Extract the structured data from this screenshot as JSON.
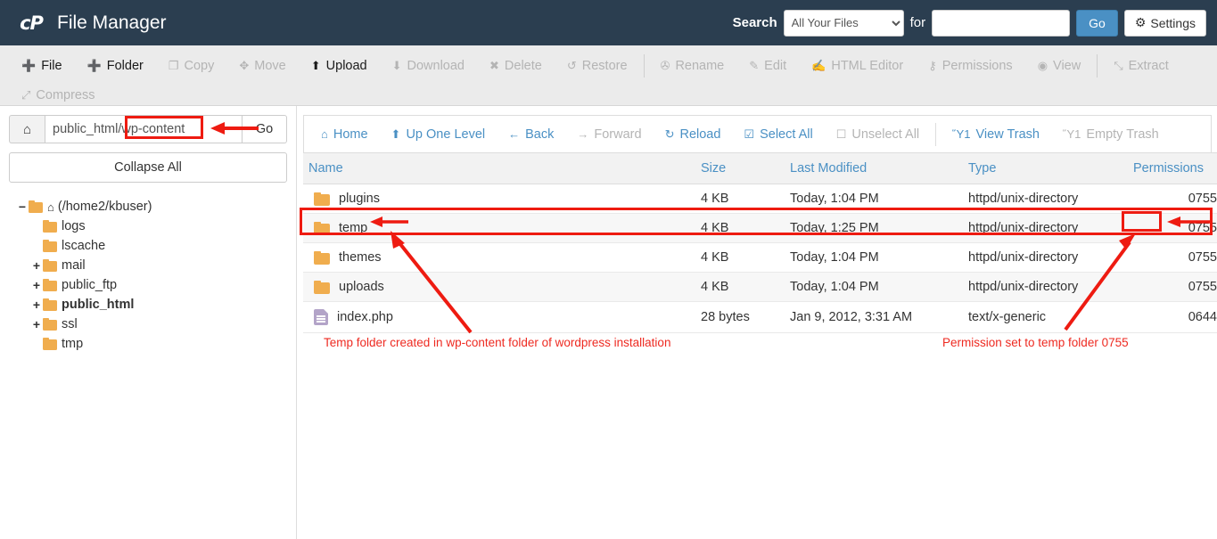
{
  "header": {
    "logo_text": "cP",
    "title": "File Manager",
    "search_label": "Search",
    "search_scope": "All Your Files",
    "search_scope_options": [
      "All Your Files"
    ],
    "for_label": "for",
    "search_value": "",
    "search_placeholder": "",
    "go_label": "Go",
    "settings_label": "Settings"
  },
  "toolbar": {
    "row1": [
      {
        "label": "File",
        "icon": "plus-icon",
        "glyph": "➕",
        "enabled": true
      },
      {
        "label": "Folder",
        "icon": "plus-icon",
        "glyph": "➕",
        "enabled": true
      },
      {
        "label": "Copy",
        "icon": "copy-icon",
        "glyph": "❐",
        "enabled": false
      },
      {
        "label": "Move",
        "icon": "move-icon",
        "glyph": "✥",
        "enabled": false
      },
      {
        "label": "Upload",
        "icon": "upload-icon",
        "glyph": "⬆",
        "enabled": true
      },
      {
        "label": "Download",
        "icon": "download-icon",
        "glyph": "⬇",
        "enabled": false
      },
      {
        "label": "Delete",
        "icon": "x-icon",
        "glyph": "✖",
        "enabled": false
      },
      {
        "label": "Restore",
        "icon": "undo-icon",
        "glyph": "↺",
        "enabled": false
      },
      {
        "label": "Rename",
        "icon": "file-icon",
        "glyph": "✇",
        "enabled": false
      },
      {
        "label": "Edit",
        "icon": "pencil-icon",
        "glyph": "✎",
        "enabled": false
      },
      {
        "label": "HTML Editor",
        "icon": "html-editor-icon",
        "glyph": "✍",
        "enabled": false
      },
      {
        "label": "Permissions",
        "icon": "key-icon",
        "glyph": "⚷",
        "enabled": false
      },
      {
        "label": "View",
        "icon": "eye-icon",
        "glyph": "◉",
        "enabled": false
      },
      {
        "label": "Extract",
        "icon": "extract-icon",
        "glyph": "⤡",
        "enabled": false
      }
    ],
    "row2": [
      {
        "label": "Compress",
        "icon": "compress-icon",
        "glyph": "⤢",
        "enabled": false
      }
    ]
  },
  "sidebar": {
    "home_icon": "home-icon",
    "path_value": "public_html/wp-content",
    "path_prefix": "public_html/",
    "path_highlighted": "wp-content",
    "go_label": "Go",
    "collapse_all_label": "Collapse All",
    "tree": [
      {
        "label": "(/home2/kbuser)",
        "toggle": "−",
        "depth": 0,
        "icon": "open-folder-icon",
        "home": true,
        "bold": false
      },
      {
        "label": "logs",
        "toggle": "",
        "depth": 1,
        "icon": "folder-icon",
        "home": false,
        "bold": false
      },
      {
        "label": "lscache",
        "toggle": "",
        "depth": 1,
        "icon": "folder-icon",
        "home": false,
        "bold": false
      },
      {
        "label": "mail",
        "toggle": "+",
        "depth": 1,
        "icon": "folder-icon",
        "home": false,
        "bold": false
      },
      {
        "label": "public_ftp",
        "toggle": "+",
        "depth": 1,
        "icon": "folder-icon",
        "home": false,
        "bold": false
      },
      {
        "label": "public_html",
        "toggle": "+",
        "depth": 1,
        "icon": "folder-icon",
        "home": false,
        "bold": true
      },
      {
        "label": "ssl",
        "toggle": "+",
        "depth": 1,
        "icon": "folder-icon",
        "home": false,
        "bold": false
      },
      {
        "label": "tmp",
        "toggle": "",
        "depth": 1,
        "icon": "folder-icon",
        "home": false,
        "bold": false
      }
    ]
  },
  "filenav": [
    {
      "label": "Home",
      "icon": "home-icon",
      "glyph": "⌂",
      "enabled": true
    },
    {
      "label": "Up One Level",
      "icon": "arrow-up-icon",
      "glyph": "⬆",
      "enabled": true
    },
    {
      "label": "Back",
      "icon": "arrow-left-icon",
      "glyph": "←",
      "enabled": true
    },
    {
      "label": "Forward",
      "icon": "arrow-right-icon",
      "glyph": "→",
      "enabled": false
    },
    {
      "label": "Reload",
      "icon": "reload-icon",
      "glyph": "↻",
      "enabled": true
    },
    {
      "label": "Select All",
      "icon": "checkbox-checked-icon",
      "glyph": "☑",
      "enabled": true
    },
    {
      "label": "Unselect All",
      "icon": "checkbox-empty-icon",
      "glyph": "☐",
      "enabled": false
    },
    {
      "sep": true
    },
    {
      "label": "View Trash",
      "icon": "trash-icon",
      "glyph": "Ὕ1",
      "enabled": true
    },
    {
      "label": "Empty Trash",
      "icon": "trash-icon",
      "glyph": "Ὕ1",
      "enabled": false
    }
  ],
  "table": {
    "columns": [
      "Name",
      "Size",
      "Last Modified",
      "Type",
      "Permissions"
    ],
    "rows": [
      {
        "name": "plugins",
        "size": "4 KB",
        "modified": "Today, 1:04 PM",
        "type": "httpd/unix-directory",
        "perms": "0755",
        "icon": "folder-icon"
      },
      {
        "name": "temp",
        "size": "4 KB",
        "modified": "Today, 1:25 PM",
        "type": "httpd/unix-directory",
        "perms": "0755",
        "icon": "folder-icon"
      },
      {
        "name": "themes",
        "size": "4 KB",
        "modified": "Today, 1:04 PM",
        "type": "httpd/unix-directory",
        "perms": "0755",
        "icon": "folder-icon"
      },
      {
        "name": "uploads",
        "size": "4 KB",
        "modified": "Today, 1:04 PM",
        "type": "httpd/unix-directory",
        "perms": "0755",
        "icon": "folder-icon"
      },
      {
        "name": "index.php",
        "size": "28 bytes",
        "modified": "Jan 9, 2012, 3:31 AM",
        "type": "text/x-generic",
        "perms": "0644",
        "icon": "file-icon"
      }
    ]
  },
  "annotations": {
    "color": "#ee2a21",
    "caption_left": "Temp folder created in wp-content folder of wordpress installation",
    "caption_right": "Permission set to temp folder 0755"
  }
}
